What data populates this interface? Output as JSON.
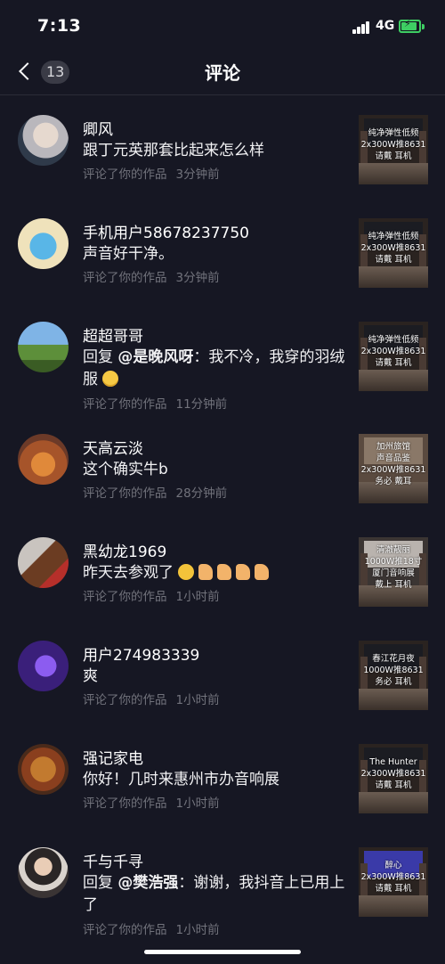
{
  "status": {
    "time": "7:13",
    "network": "4G"
  },
  "nav": {
    "title": "评论",
    "badge": "13"
  },
  "comments": [
    {
      "name": "卿风",
      "message": "跟丁元英那套比起来怎么样",
      "action": "评论了你的作品",
      "time": "3分钟前",
      "thumb_text": [
        "纯净弹性低频",
        "2x300W推8631",
        "请戴  耳机"
      ]
    },
    {
      "name": "手机用户58678237750",
      "message": "声音好干净。",
      "action": "评论了你的作品",
      "time": "3分钟前",
      "thumb_text": [
        "纯净弹性低频",
        "2x300W推8631",
        "请戴  耳机"
      ]
    },
    {
      "name": "超超哥哥",
      "reply_prefix": "回复",
      "mention": "@是晚风呀",
      "message": "：我不冷，我穿的羽绒服",
      "action": "评论了你的作品",
      "time": "11分钟前",
      "thumb_text": [
        "纯净弹性低频",
        "2x300W推8631",
        "请戴  耳机"
      ]
    },
    {
      "name": "天高云淡",
      "message": "这个确实牛b",
      "action": "评论了你的作品",
      "time": "28分钟前",
      "thumb_text": [
        "加州旅馆",
        "声音品鉴",
        "2x300W推8631",
        "务必  戴耳"
      ]
    },
    {
      "name": "黑幼龙1969",
      "message": "昨天去参观了",
      "action": "评论了你的作品",
      "time": "1小时前",
      "thumb_text": [
        "清澈靓丽",
        "1000W推18寸",
        "厦门音响展",
        "戴上  耳机"
      ]
    },
    {
      "name": "用户274983339",
      "message": "爽",
      "action": "评论了你的作品",
      "time": "1小时前",
      "thumb_text": [
        "春江花月夜",
        "1000W推8631",
        "务必  耳机"
      ]
    },
    {
      "name": "强记家电",
      "message": "你好！几时来惠州市办音响展",
      "action": "评论了你的作品",
      "time": "1小时前",
      "thumb_text": [
        "The Hunter",
        "2x300W推8631",
        "请戴  耳机"
      ]
    },
    {
      "name": "千与千寻",
      "reply_prefix": "回复",
      "mention": "@樊浩强",
      "message": "：谢谢，我抖音上已用上了",
      "action": "评论了你的作品",
      "time": "1小时前",
      "thumb_text": [
        "醉心",
        "2x300W推8631",
        "请戴  耳机"
      ]
    }
  ],
  "colors": {
    "background": "#161723",
    "meta": "#72737c",
    "battery": "#3ecf63"
  },
  "icons": [
    "back-arrow-icon",
    "signal-icon",
    "battery-icon",
    "smile-emoji-icon",
    "thinking-emoji-icon",
    "thumbs-up-emoji-icon"
  ]
}
